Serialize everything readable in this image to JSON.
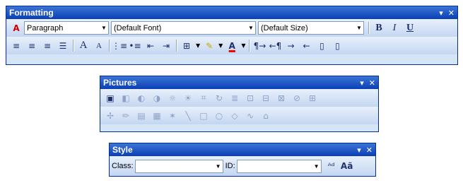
{
  "formatting": {
    "title": "Formatting",
    "style_combo": "Paragraph",
    "font_combo": "(Default Font)",
    "size_combo": "(Default Size)",
    "bold": "B",
    "italic": "I",
    "underline": "U",
    "increase_font": "A",
    "decrease_font": "A"
  },
  "pictures": {
    "title": "Pictures"
  },
  "style": {
    "title": "Style",
    "class_label": "Class:",
    "id_label": "ID:",
    "class_value": "",
    "id_value": ""
  },
  "colors": {
    "title_bar": "#0a3fb5",
    "toolbar_bg": "#d6e4f7",
    "highlight": "#ffff00",
    "font_color": "#ff0000"
  }
}
